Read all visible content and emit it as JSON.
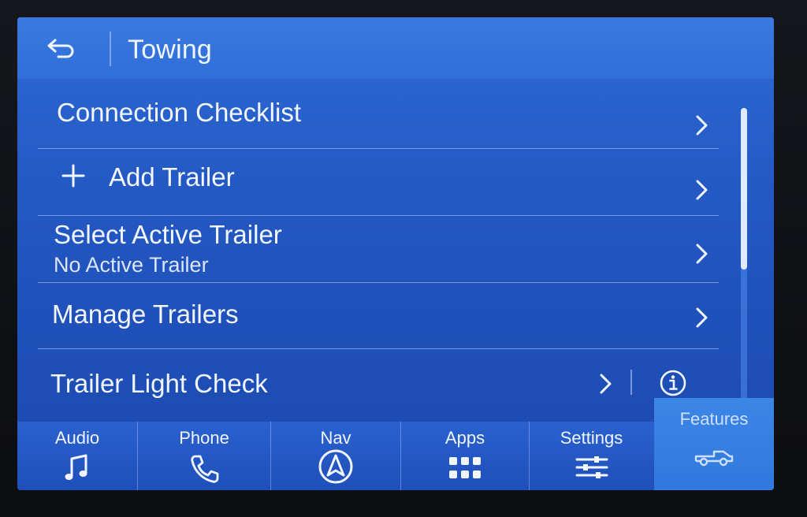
{
  "header": {
    "title": "Towing",
    "back_icon": "back-arrow-icon"
  },
  "list": {
    "items": [
      {
        "label": "Connection Checklist",
        "sublabel": "",
        "icon": "chevron-right-icon"
      },
      {
        "label": "Add Trailer",
        "sublabel": "",
        "leading_icon": "plus-icon",
        "icon": "chevron-right-icon"
      },
      {
        "label": "Select Active Trailer",
        "sublabel": "No Active Trailer",
        "icon": "chevron-right-icon"
      },
      {
        "label": "Manage Trailers",
        "sublabel": "",
        "icon": "chevron-right-icon"
      },
      {
        "label": "Trailer Light Check",
        "sublabel": "",
        "icon": "chevron-right-icon",
        "extra_icon": "info-icon"
      }
    ]
  },
  "tabs": [
    {
      "label": "Audio",
      "icon": "music-note-icon"
    },
    {
      "label": "Phone",
      "icon": "phone-icon"
    },
    {
      "label": "Nav",
      "icon": "navigation-arrow-icon"
    },
    {
      "label": "Apps",
      "icon": "apps-grid-icon"
    },
    {
      "label": "Settings",
      "icon": "sliders-icon"
    },
    {
      "label": "Features",
      "icon": "truck-icon",
      "active": true
    }
  ],
  "colors": {
    "screen_blue": "#2459c4",
    "header_blue": "#306ed8",
    "active_tab": "#3078de",
    "text": "#f2f6ff"
  }
}
